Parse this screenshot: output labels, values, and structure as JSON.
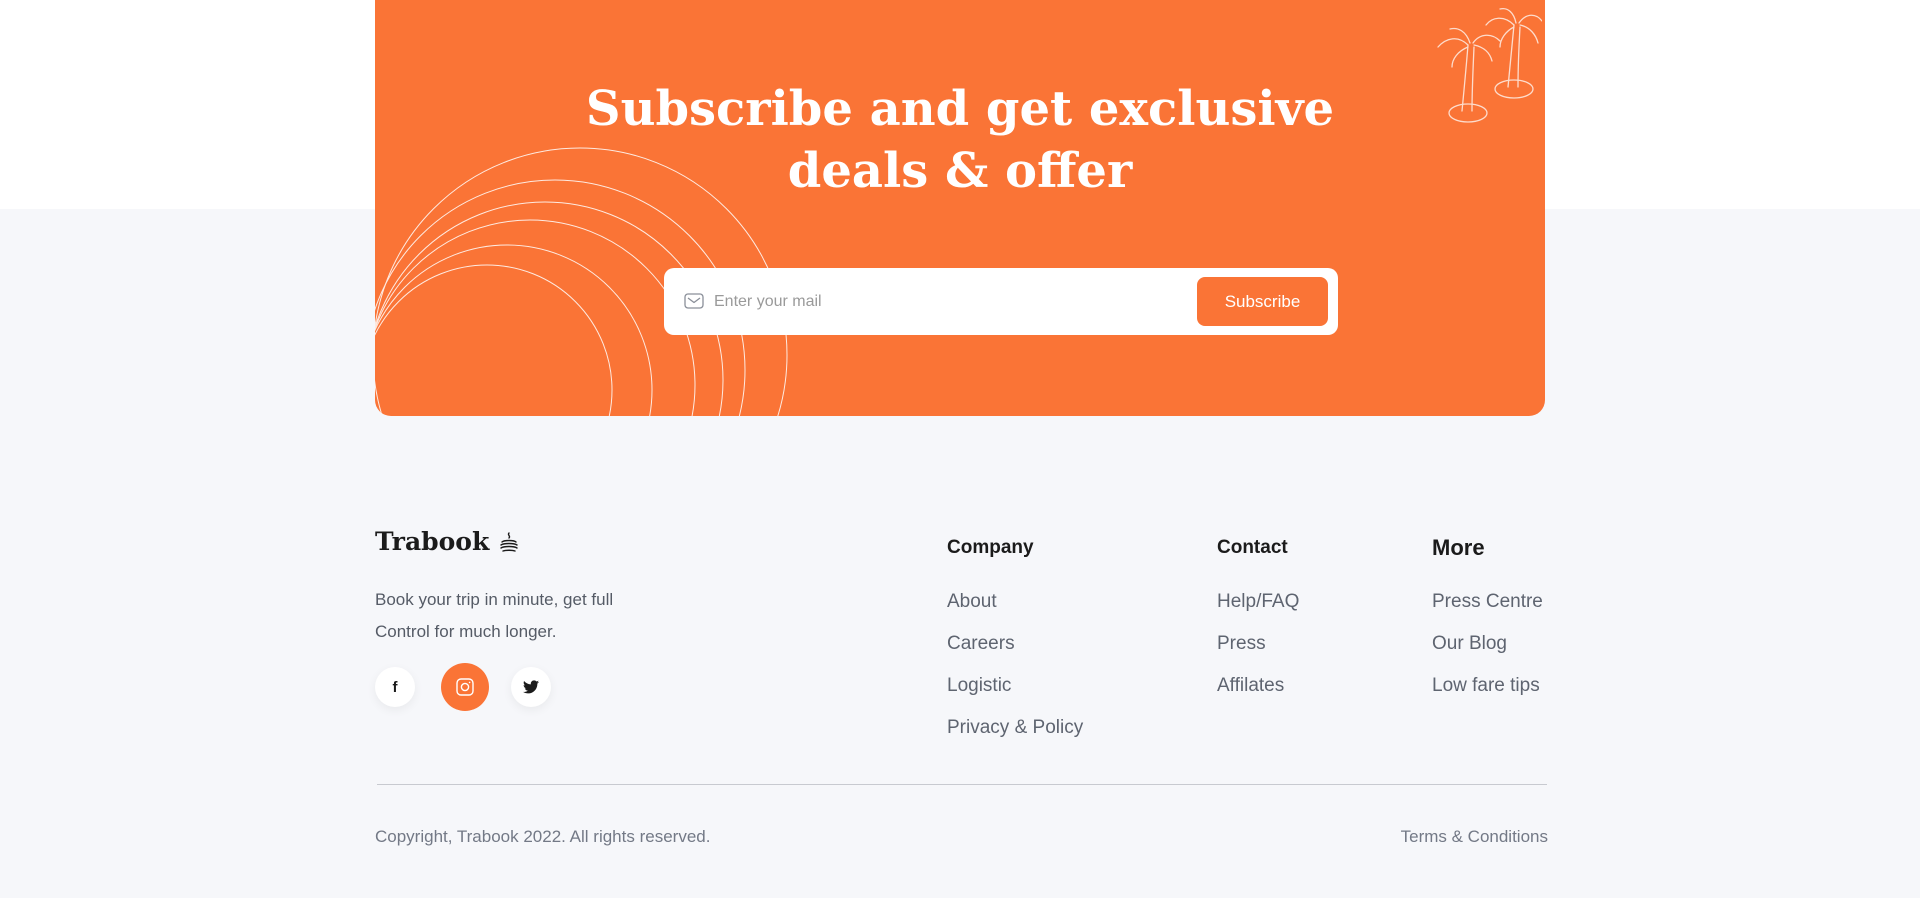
{
  "subscribe": {
    "title_line1": "Subscribe and get exclusive",
    "title_line2": "deals & offer",
    "placeholder": "Enter your mail",
    "button": "Subscribe",
    "mail_icon": "mail-icon",
    "decoration_icons": [
      "circle-rings",
      "palm-trees"
    ]
  },
  "footer": {
    "brand": {
      "name": "Trabook",
      "icon": "stacked-dishes-icon"
    },
    "tagline_line1": "Book your trip in minute, get full",
    "tagline_line2": "Control for much longer.",
    "social": [
      {
        "name": "facebook",
        "icon": "facebook-icon",
        "glyph": "f",
        "active": false
      },
      {
        "name": "instagram",
        "icon": "instagram-icon",
        "active": true
      },
      {
        "name": "twitter",
        "icon": "twitter-icon",
        "active": false
      }
    ],
    "columns": [
      {
        "title": "Company",
        "links": [
          "About",
          "Careers",
          "Logistic",
          "Privacy & Policy"
        ]
      },
      {
        "title": "Contact",
        "links": [
          "Help/FAQ",
          "Press",
          "Affilates"
        ]
      },
      {
        "title": "More",
        "links": [
          "Press Centre",
          "Our Blog",
          "Low fare tips"
        ]
      }
    ],
    "copyright": "Copyright, Trabook 2022. All rights reserved.",
    "terms": "Terms & Conditions"
  },
  "colors": {
    "accent": "#fa7436",
    "background": "#f6f7fa",
    "heading": "#1b1b1b",
    "text": "#5e6470",
    "muted": "#737986"
  }
}
